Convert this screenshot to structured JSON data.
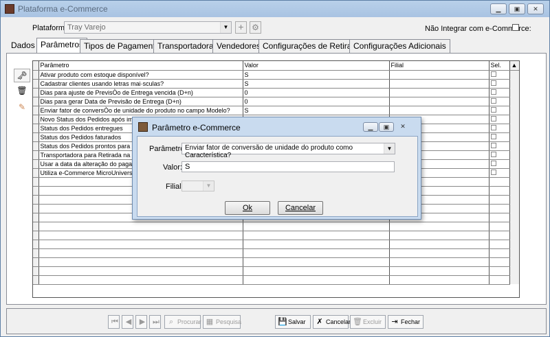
{
  "window": {
    "title": "Plataforma e-Commerce"
  },
  "header": {
    "plataforma_label": "Plataforma:",
    "plataforma_value": "Tray Varejo",
    "nao_integrar_label": "Não Integrar com e-Commerce:"
  },
  "tabs": [
    "Dados",
    "Parâmetros",
    "Tipos de Pagamento",
    "Transportadoras",
    "Vendedores",
    "Configurações de Retirada",
    "Configurações Adicionais"
  ],
  "grid": {
    "columns": [
      "Parâmetro",
      "Valor",
      "Filial",
      "Sel."
    ],
    "rows": [
      {
        "param": "Ativar produto com estoque disponível?",
        "valor": "S",
        "filial": ""
      },
      {
        "param": "Cadastrar clientes usando letras mai·sculas?",
        "valor": "S",
        "filial": ""
      },
      {
        "param": "Dias para ajuste de PrevisÒo de Entrega vencida (D+n)",
        "valor": "0",
        "filial": ""
      },
      {
        "param": "Dias para gerar Data de Previsão de Entrega (D+n)",
        "valor": "0",
        "filial": ""
      },
      {
        "param": "Enviar fator de conversÒo de unidade do produto no campo Modelo?",
        "valor": "S",
        "filial": ""
      },
      {
        "param": "Novo Status dos Pedidos após imp",
        "valor": "",
        "filial": ""
      },
      {
        "param": "Status dos Pedidos entregues",
        "valor": "",
        "filial": ""
      },
      {
        "param": "Status dos Pedidos faturados",
        "valor": "",
        "filial": ""
      },
      {
        "param": "Status dos Pedidos prontos para r",
        "valor": "",
        "filial": ""
      },
      {
        "param": "Transportadora para Retirada na L",
        "valor": "",
        "filial": ""
      },
      {
        "param": "Usar a data da alteração do pagan",
        "valor": "",
        "filial": ""
      },
      {
        "param": "Utiliza e-Commerce MicroUniverso",
        "valor": "",
        "filial": ""
      }
    ],
    "empty_rows": 12
  },
  "bottom": {
    "procurar": "Procurar",
    "pesquisa": "Pesquisa",
    "salvar": "Salvar",
    "cancelar": "Cancelar",
    "excluir": "Excluir",
    "fechar": "Fechar"
  },
  "dialog": {
    "title": "Parâmetro e-Commerce",
    "parametro_label": "Parâmetro:",
    "parametro_value": "Enviar fator de conversão de unidade do produto como Característica?",
    "valor_label": "Valor:",
    "valor_value": "S",
    "filial_label": "Filial:",
    "filial_value": "",
    "ok": "Ok",
    "cancelar": "Cancelar"
  }
}
